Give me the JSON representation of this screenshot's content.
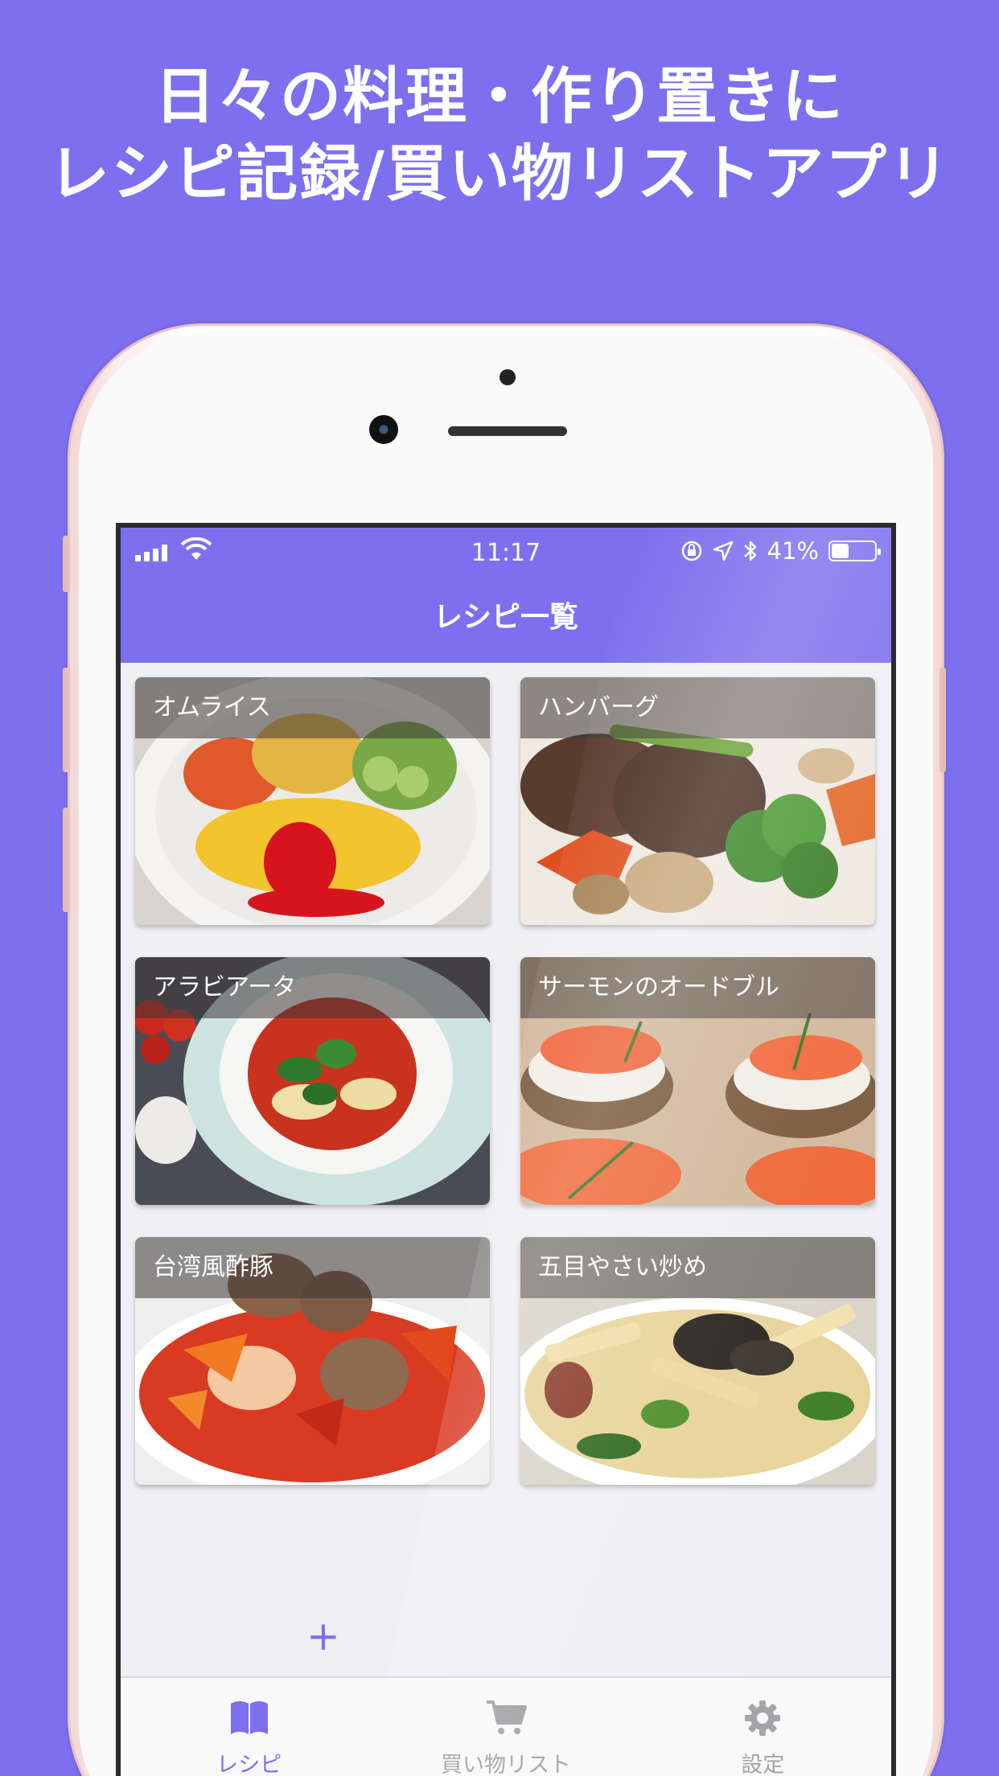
{
  "headline": {
    "line1": "日々の料理・作り置きに",
    "line2": "レシピ記録/買い物リストアプリ"
  },
  "status_bar": {
    "time": "11:17",
    "battery_text": "41%",
    "battery_level": 0.41
  },
  "navbar": {
    "title": "レシピ一覧"
  },
  "recipes": [
    {
      "name": "オムライス",
      "icon": "omurice-photo"
    },
    {
      "name": "ハンバーグ",
      "icon": "hamburg-photo"
    },
    {
      "name": "アラビアータ",
      "icon": "arrabbiata-photo"
    },
    {
      "name": "サーモンのオードブル",
      "icon": "salmon-hors-doeuvre-photo"
    },
    {
      "name": "台湾風酢豚",
      "icon": "sweet-sour-pork-photo"
    },
    {
      "name": "五目やさい炒め",
      "icon": "stir-fry-vegetables-photo"
    }
  ],
  "add_button": {
    "symbol": "+"
  },
  "tabbar": {
    "tabs": [
      {
        "label": "レシピ",
        "icon": "book-icon",
        "active": true
      },
      {
        "label": "買い物リスト",
        "icon": "cart-icon",
        "active": false
      },
      {
        "label": "設定",
        "icon": "gear-icon",
        "active": false
      }
    ]
  },
  "colors": {
    "accent": "#7d6fee",
    "inactive": "#a3a3a8"
  }
}
